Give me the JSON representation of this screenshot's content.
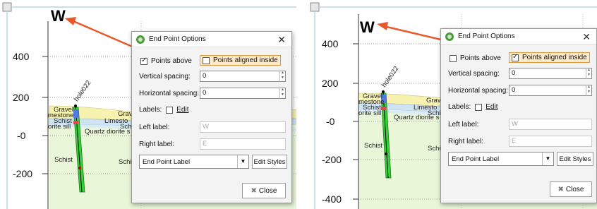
{
  "panels": [
    {
      "id": "left",
      "y_ticks": [
        "400",
        "200",
        "-0",
        "-200"
      ],
      "direction_label": "W",
      "hole_label": "hole022",
      "unit_labels": {
        "gravel": "Gravel",
        "limestone": "mestone",
        "schist_upper": "Schist",
        "diorite_sill": "orite sill",
        "quartz_diorite": "Quartz diorite s",
        "gravel_r": "Grav",
        "limestone_r": "Limesto",
        "schist_r": "Schi",
        "schist_lower": "Schist",
        "schist_lower_r": "Schi"
      },
      "dialog": {
        "title": "End Point Options",
        "points_above": "Points above",
        "points_above_checked": true,
        "points_aligned_inside": "Points aligned inside",
        "points_aligned_inside_checked": false,
        "vertical_spacing_label": "Vertical spacing:",
        "vertical_spacing_value": "0",
        "horizontal_spacing_label": "Horizontal spacing:",
        "horizontal_spacing_value": "0",
        "labels_label": "Labels:",
        "edit_label": "Edit",
        "edit_checked": false,
        "left_label_label": "Left label:",
        "left_label_value": "W",
        "right_label_label": "Right label:",
        "right_label_value": "E",
        "end_point_select": "End Point Label",
        "edit_styles": "Edit Styles",
        "close": "Close"
      }
    },
    {
      "id": "right",
      "y_ticks": [
        "400",
        "200",
        "-0",
        "-200",
        "-400"
      ],
      "direction_label": "W",
      "hole_label": "hole022",
      "unit_labels": {
        "gravel": "Gravel",
        "limestone": "mestone",
        "schist_upper": "Schist",
        "diorite_sill": "orite sill",
        "quartz_diorite": "Quartz diorite s",
        "gravel_r": "Grav",
        "limestone_r": "Limesto",
        "schist_r": "Schi",
        "schist_lower": "Schist",
        "schist_lower_r": "Schi"
      },
      "dialog": {
        "title": "End Point Options",
        "points_above": "Points above",
        "points_above_checked": false,
        "points_aligned_inside": "Points aligned inside",
        "points_aligned_inside_checked": true,
        "vertical_spacing_label": "Vertical spacing:",
        "vertical_spacing_value": "0",
        "horizontal_spacing_label": "Horizontal spacing:",
        "horizontal_spacing_value": "0",
        "labels_label": "Labels:",
        "edit_label": "Edit",
        "edit_checked": false,
        "left_label_label": "Left label:",
        "left_label_value": "W",
        "right_label_label": "Right label:",
        "right_label_value": "E",
        "end_point_select": "End Point Label",
        "edit_styles": "Edit Styles",
        "close": "Close"
      }
    }
  ],
  "colors": {
    "arrow": "#e8582a",
    "highlight": "#e39a3a",
    "schist_fill": "#e9f6d8",
    "drillhole": "#3ccf3c"
  },
  "icons": [
    "app-icon",
    "close-icon",
    "spinner-icon",
    "dropdown-arrow-icon",
    "close-button-icon",
    "corner-handle-icon"
  ]
}
